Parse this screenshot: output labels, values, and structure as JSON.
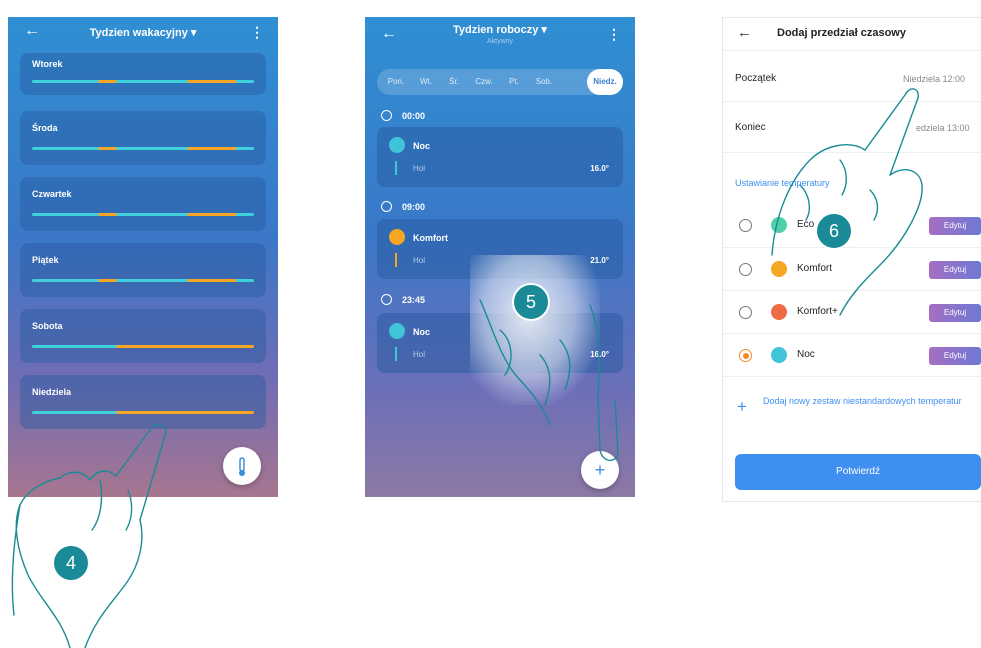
{
  "screen1": {
    "title": "Tydzien wakacyjny ▾",
    "days": [
      {
        "name": "Wtorek"
      },
      {
        "name": "Środa"
      },
      {
        "name": "Czwartek"
      },
      {
        "name": "Piątek"
      },
      {
        "name": "Sobota"
      },
      {
        "name": "Niedziela"
      }
    ],
    "fab_icon": "thermometer-icon"
  },
  "screen2": {
    "title": "Tydzien roboczy ▾",
    "subtitle": "Aktywny",
    "tabs": [
      "Pon.",
      "Wt.",
      "Śr.",
      "Czw.",
      "Pt.",
      "Sob.",
      "Niedz."
    ],
    "selected_tab": "Niedz.",
    "slots": [
      {
        "time": "00:00",
        "name": "Noc",
        "room": "Hol",
        "temp": "16.0°",
        "icon": "moon-icon",
        "color": "#3fc4d8"
      },
      {
        "time": "09:00",
        "name": "Komfort",
        "room": "Hol",
        "temp": "21.0°",
        "icon": "sun-icon",
        "color": "#f5a623"
      },
      {
        "time": "23:45",
        "name": "Noc",
        "room": "Hol",
        "temp": "16.0°",
        "icon": "moon-icon",
        "color": "#3fc4d8"
      }
    ],
    "fab_label": "+"
  },
  "screen3": {
    "title": "Dodaj przedział czasowy",
    "start_label": "Początek",
    "start_value": "Niedziela 12:00",
    "end_label": "Koniec",
    "end_value": "edziela 13:00",
    "section_label": "Ustawianie temperatury",
    "options": [
      {
        "label": "Eco",
        "edit": "Edytuj",
        "selected": false,
        "icon": "leaf-icon",
        "color": "#4fd0a8"
      },
      {
        "label": "Komfort",
        "edit": "Edytuj",
        "selected": false,
        "icon": "sun-icon",
        "color": "#f5a623"
      },
      {
        "label": "Komfort+",
        "edit": "Edytuj",
        "selected": false,
        "icon": "flame-icon",
        "color": "#f06a45"
      },
      {
        "label": "Noc",
        "edit": "Edytuj",
        "selected": true,
        "icon": "moon-icon",
        "color": "#3fc4d8"
      }
    ],
    "add_custom": "Dodaj nowy zestaw niestandardowych temperatur",
    "confirm": "Potwierdź"
  },
  "steps": [
    "4",
    "5",
    "6"
  ],
  "colors": {
    "accent": "#3e8ff0",
    "step_badge": "#1a8b96",
    "bar_cyan": "#3fd0dc",
    "bar_orange": "#f5a623"
  }
}
